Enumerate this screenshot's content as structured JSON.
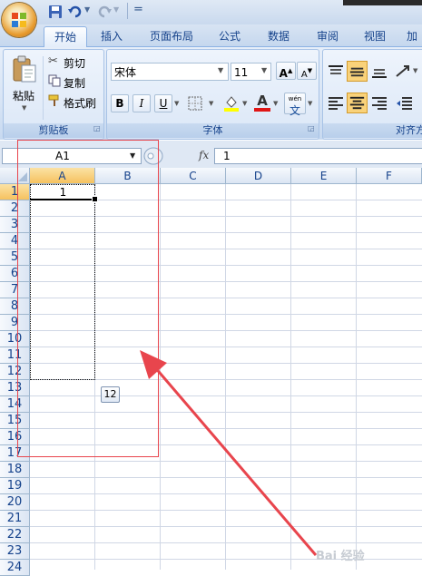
{
  "quick_access": {
    "separator": "="
  },
  "tabs": [
    "开始",
    "插入",
    "页面布局",
    "公式",
    "数据",
    "审阅",
    "视图",
    "加"
  ],
  "clipboard": {
    "paste": "粘贴",
    "cut": "剪切",
    "copy": "复制",
    "format_painter": "格式刷",
    "group_label": "剪贴板"
  },
  "font": {
    "name": "宋体",
    "size": "11",
    "grow": "A",
    "shrink": "A",
    "bold": "B",
    "italic": "I",
    "underline": "U",
    "phonetic_top": "wén",
    "phonetic": "文",
    "font_color_letter": "A",
    "group_label": "字体"
  },
  "alignment": {
    "group_label": "对齐方"
  },
  "formula_bar": {
    "name_box": "A1",
    "fx": "fx",
    "content": "1"
  },
  "columns": [
    "A",
    "B",
    "C",
    "D",
    "E",
    "F"
  ],
  "rows": [
    "1",
    "2",
    "3",
    "4",
    "5",
    "6",
    "7",
    "8",
    "9",
    "10",
    "11",
    "12",
    "13",
    "14",
    "15",
    "16",
    "17",
    "18",
    "19",
    "20",
    "21",
    "22",
    "23",
    "24"
  ],
  "cells": {
    "A1": "1"
  },
  "autofill_tooltip": "12",
  "watermark": "Bai 经验",
  "colors": {
    "annotation": "#e8454d",
    "highlight": "#f8cf6e",
    "tab_text": "#15428b"
  }
}
